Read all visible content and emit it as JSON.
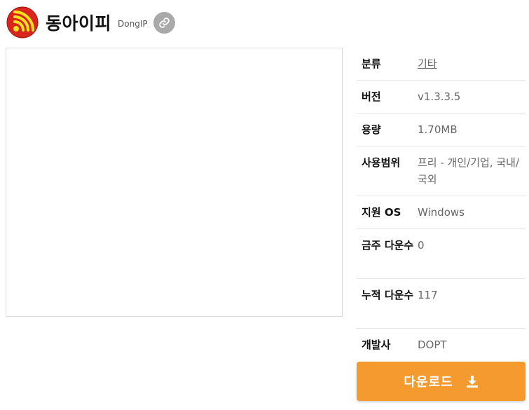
{
  "app": {
    "title": "동아이피",
    "subtitle": "DongIP",
    "icon": "wifi-signal-logo",
    "link_icon": "link-icon"
  },
  "info": [
    {
      "label": "분류",
      "value": "기타"
    },
    {
      "label": "버전",
      "value": "v1.3.3.5"
    },
    {
      "label": "용량",
      "value": "1.70MB"
    },
    {
      "label": "사용범위",
      "value": "프리 - 개인/기업, 국내/국외"
    },
    {
      "label": "지원 OS",
      "value": "Windows"
    },
    {
      "label": "금주 다운수",
      "value": "0"
    },
    {
      "label": "누적 다운수",
      "value": "117"
    },
    {
      "label": "개발사",
      "value": "DOPT"
    }
  ],
  "download": {
    "label": "다운로드",
    "icon": "download-icon"
  },
  "colors": {
    "accent": "#f59a2e",
    "link_button": "#a9a9a9",
    "logo_red": "#d8261c",
    "logo_yellow": "#f7e21b"
  }
}
